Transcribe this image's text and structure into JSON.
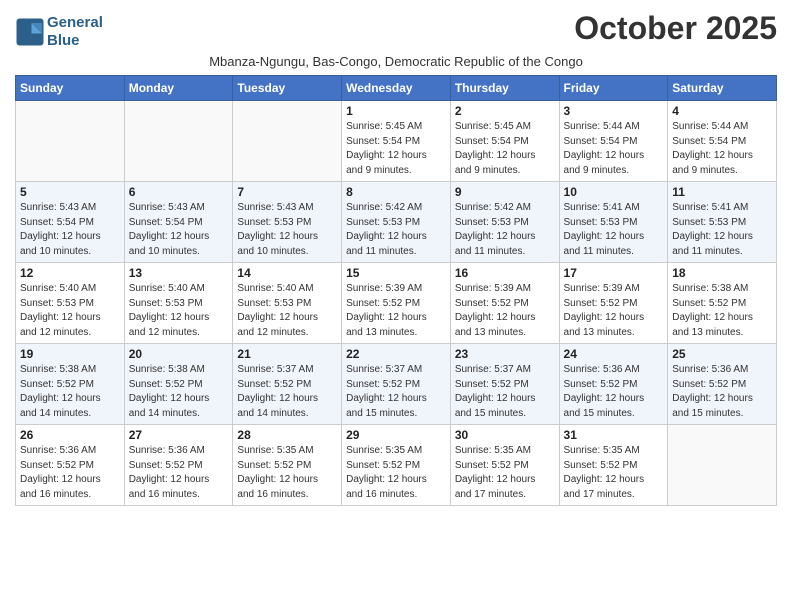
{
  "header": {
    "logo_line1": "General",
    "logo_line2": "Blue",
    "month_title": "October 2025",
    "subtitle": "Mbanza-Ngungu, Bas-Congo, Democratic Republic of the Congo"
  },
  "weekdays": [
    "Sunday",
    "Monday",
    "Tuesday",
    "Wednesday",
    "Thursday",
    "Friday",
    "Saturday"
  ],
  "weeks": [
    [
      {
        "day": "",
        "info": ""
      },
      {
        "day": "",
        "info": ""
      },
      {
        "day": "",
        "info": ""
      },
      {
        "day": "1",
        "info": "Sunrise: 5:45 AM\nSunset: 5:54 PM\nDaylight: 12 hours\nand 9 minutes."
      },
      {
        "day": "2",
        "info": "Sunrise: 5:45 AM\nSunset: 5:54 PM\nDaylight: 12 hours\nand 9 minutes."
      },
      {
        "day": "3",
        "info": "Sunrise: 5:44 AM\nSunset: 5:54 PM\nDaylight: 12 hours\nand 9 minutes."
      },
      {
        "day": "4",
        "info": "Sunrise: 5:44 AM\nSunset: 5:54 PM\nDaylight: 12 hours\nand 9 minutes."
      }
    ],
    [
      {
        "day": "5",
        "info": "Sunrise: 5:43 AM\nSunset: 5:54 PM\nDaylight: 12 hours\nand 10 minutes."
      },
      {
        "day": "6",
        "info": "Sunrise: 5:43 AM\nSunset: 5:54 PM\nDaylight: 12 hours\nand 10 minutes."
      },
      {
        "day": "7",
        "info": "Sunrise: 5:43 AM\nSunset: 5:53 PM\nDaylight: 12 hours\nand 10 minutes."
      },
      {
        "day": "8",
        "info": "Sunrise: 5:42 AM\nSunset: 5:53 PM\nDaylight: 12 hours\nand 11 minutes."
      },
      {
        "day": "9",
        "info": "Sunrise: 5:42 AM\nSunset: 5:53 PM\nDaylight: 12 hours\nand 11 minutes."
      },
      {
        "day": "10",
        "info": "Sunrise: 5:41 AM\nSunset: 5:53 PM\nDaylight: 12 hours\nand 11 minutes."
      },
      {
        "day": "11",
        "info": "Sunrise: 5:41 AM\nSunset: 5:53 PM\nDaylight: 12 hours\nand 11 minutes."
      }
    ],
    [
      {
        "day": "12",
        "info": "Sunrise: 5:40 AM\nSunset: 5:53 PM\nDaylight: 12 hours\nand 12 minutes."
      },
      {
        "day": "13",
        "info": "Sunrise: 5:40 AM\nSunset: 5:53 PM\nDaylight: 12 hours\nand 12 minutes."
      },
      {
        "day": "14",
        "info": "Sunrise: 5:40 AM\nSunset: 5:53 PM\nDaylight: 12 hours\nand 12 minutes."
      },
      {
        "day": "15",
        "info": "Sunrise: 5:39 AM\nSunset: 5:52 PM\nDaylight: 12 hours\nand 13 minutes."
      },
      {
        "day": "16",
        "info": "Sunrise: 5:39 AM\nSunset: 5:52 PM\nDaylight: 12 hours\nand 13 minutes."
      },
      {
        "day": "17",
        "info": "Sunrise: 5:39 AM\nSunset: 5:52 PM\nDaylight: 12 hours\nand 13 minutes."
      },
      {
        "day": "18",
        "info": "Sunrise: 5:38 AM\nSunset: 5:52 PM\nDaylight: 12 hours\nand 13 minutes."
      }
    ],
    [
      {
        "day": "19",
        "info": "Sunrise: 5:38 AM\nSunset: 5:52 PM\nDaylight: 12 hours\nand 14 minutes."
      },
      {
        "day": "20",
        "info": "Sunrise: 5:38 AM\nSunset: 5:52 PM\nDaylight: 12 hours\nand 14 minutes."
      },
      {
        "day": "21",
        "info": "Sunrise: 5:37 AM\nSunset: 5:52 PM\nDaylight: 12 hours\nand 14 minutes."
      },
      {
        "day": "22",
        "info": "Sunrise: 5:37 AM\nSunset: 5:52 PM\nDaylight: 12 hours\nand 15 minutes."
      },
      {
        "day": "23",
        "info": "Sunrise: 5:37 AM\nSunset: 5:52 PM\nDaylight: 12 hours\nand 15 minutes."
      },
      {
        "day": "24",
        "info": "Sunrise: 5:36 AM\nSunset: 5:52 PM\nDaylight: 12 hours\nand 15 minutes."
      },
      {
        "day": "25",
        "info": "Sunrise: 5:36 AM\nSunset: 5:52 PM\nDaylight: 12 hours\nand 15 minutes."
      }
    ],
    [
      {
        "day": "26",
        "info": "Sunrise: 5:36 AM\nSunset: 5:52 PM\nDaylight: 12 hours\nand 16 minutes."
      },
      {
        "day": "27",
        "info": "Sunrise: 5:36 AM\nSunset: 5:52 PM\nDaylight: 12 hours\nand 16 minutes."
      },
      {
        "day": "28",
        "info": "Sunrise: 5:35 AM\nSunset: 5:52 PM\nDaylight: 12 hours\nand 16 minutes."
      },
      {
        "day": "29",
        "info": "Sunrise: 5:35 AM\nSunset: 5:52 PM\nDaylight: 12 hours\nand 16 minutes."
      },
      {
        "day": "30",
        "info": "Sunrise: 5:35 AM\nSunset: 5:52 PM\nDaylight: 12 hours\nand 17 minutes."
      },
      {
        "day": "31",
        "info": "Sunrise: 5:35 AM\nSunset: 5:52 PM\nDaylight: 12 hours\nand 17 minutes."
      },
      {
        "day": "",
        "info": ""
      }
    ]
  ]
}
